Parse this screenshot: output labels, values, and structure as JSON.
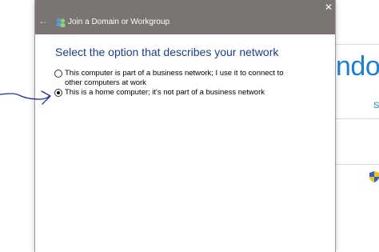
{
  "dialog": {
    "title": "Join a Domain or Workgroup",
    "close_symbol": "✕",
    "back_symbol": "←",
    "heading": "Select the option that describes your network",
    "options": [
      {
        "label": "This computer is part of a business network; I use it to connect to other computers at work",
        "selected": false
      },
      {
        "label": "This is a home computer; it's not part of a business network",
        "selected": true
      }
    ]
  },
  "background": {
    "windows_text": "ndows",
    "link_text": "S",
    "shield_icon": "uac-shield-icon"
  },
  "annotation": {
    "color": "#1a2fa8",
    "icon": "hand-drawn-arrow-icon"
  },
  "colors": {
    "titlebar": "#7a7572",
    "heading": "#1a3d91",
    "accent": "#1c7fd6"
  }
}
